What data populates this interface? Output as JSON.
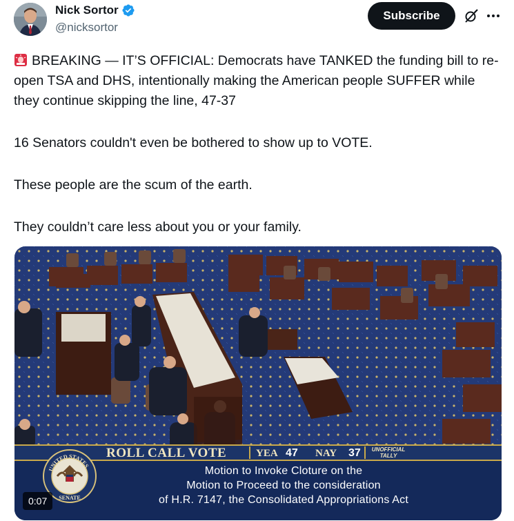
{
  "author": {
    "display_name": "Nick Sortor",
    "handle": "@nicksortor"
  },
  "actions": {
    "subscribe_label": "Subscribe"
  },
  "icons": {
    "verified": "verified-badge-icon",
    "grok": "grok-icon",
    "more": "more-options-icon",
    "siren": "rotating-light-emoji"
  },
  "colors": {
    "verified": "#1d9bf0",
    "subscribe_bg": "#0f1419",
    "text": "#0f1419",
    "secondary": "#536471"
  },
  "tweet": {
    "paragraphs": [
      "BREAKING — IT’S OFFICIAL: Democrats have TANKED the funding bill to re-open TSA and DHS, intentionally making the American people SUFFER while they continue skipping the line, 47-37",
      "16 Senators couldn't even be bothered to show up to VOTE.",
      "These people are the scum of the earth.",
      "They couldn’t care less about you or your family."
    ]
  },
  "video": {
    "timestamp": "0:07",
    "roll_call": {
      "title": "ROLL CALL VOTE",
      "yea_label": "YEA",
      "yea_value": "47",
      "nay_label": "NAY",
      "nay_value": "37",
      "unofficial_line1": "UNOFFICIAL",
      "unofficial_line2": "TALLY"
    },
    "motion": {
      "line1": "Motion to Invoke Cloture on the",
      "line2": "Motion to Proceed to the consideration",
      "line3": "of H.R. 7147, the Consolidated Appropriations Act"
    },
    "seal": {
      "top_text": "UNITED STATES",
      "bottom_text": "SENATE"
    }
  }
}
